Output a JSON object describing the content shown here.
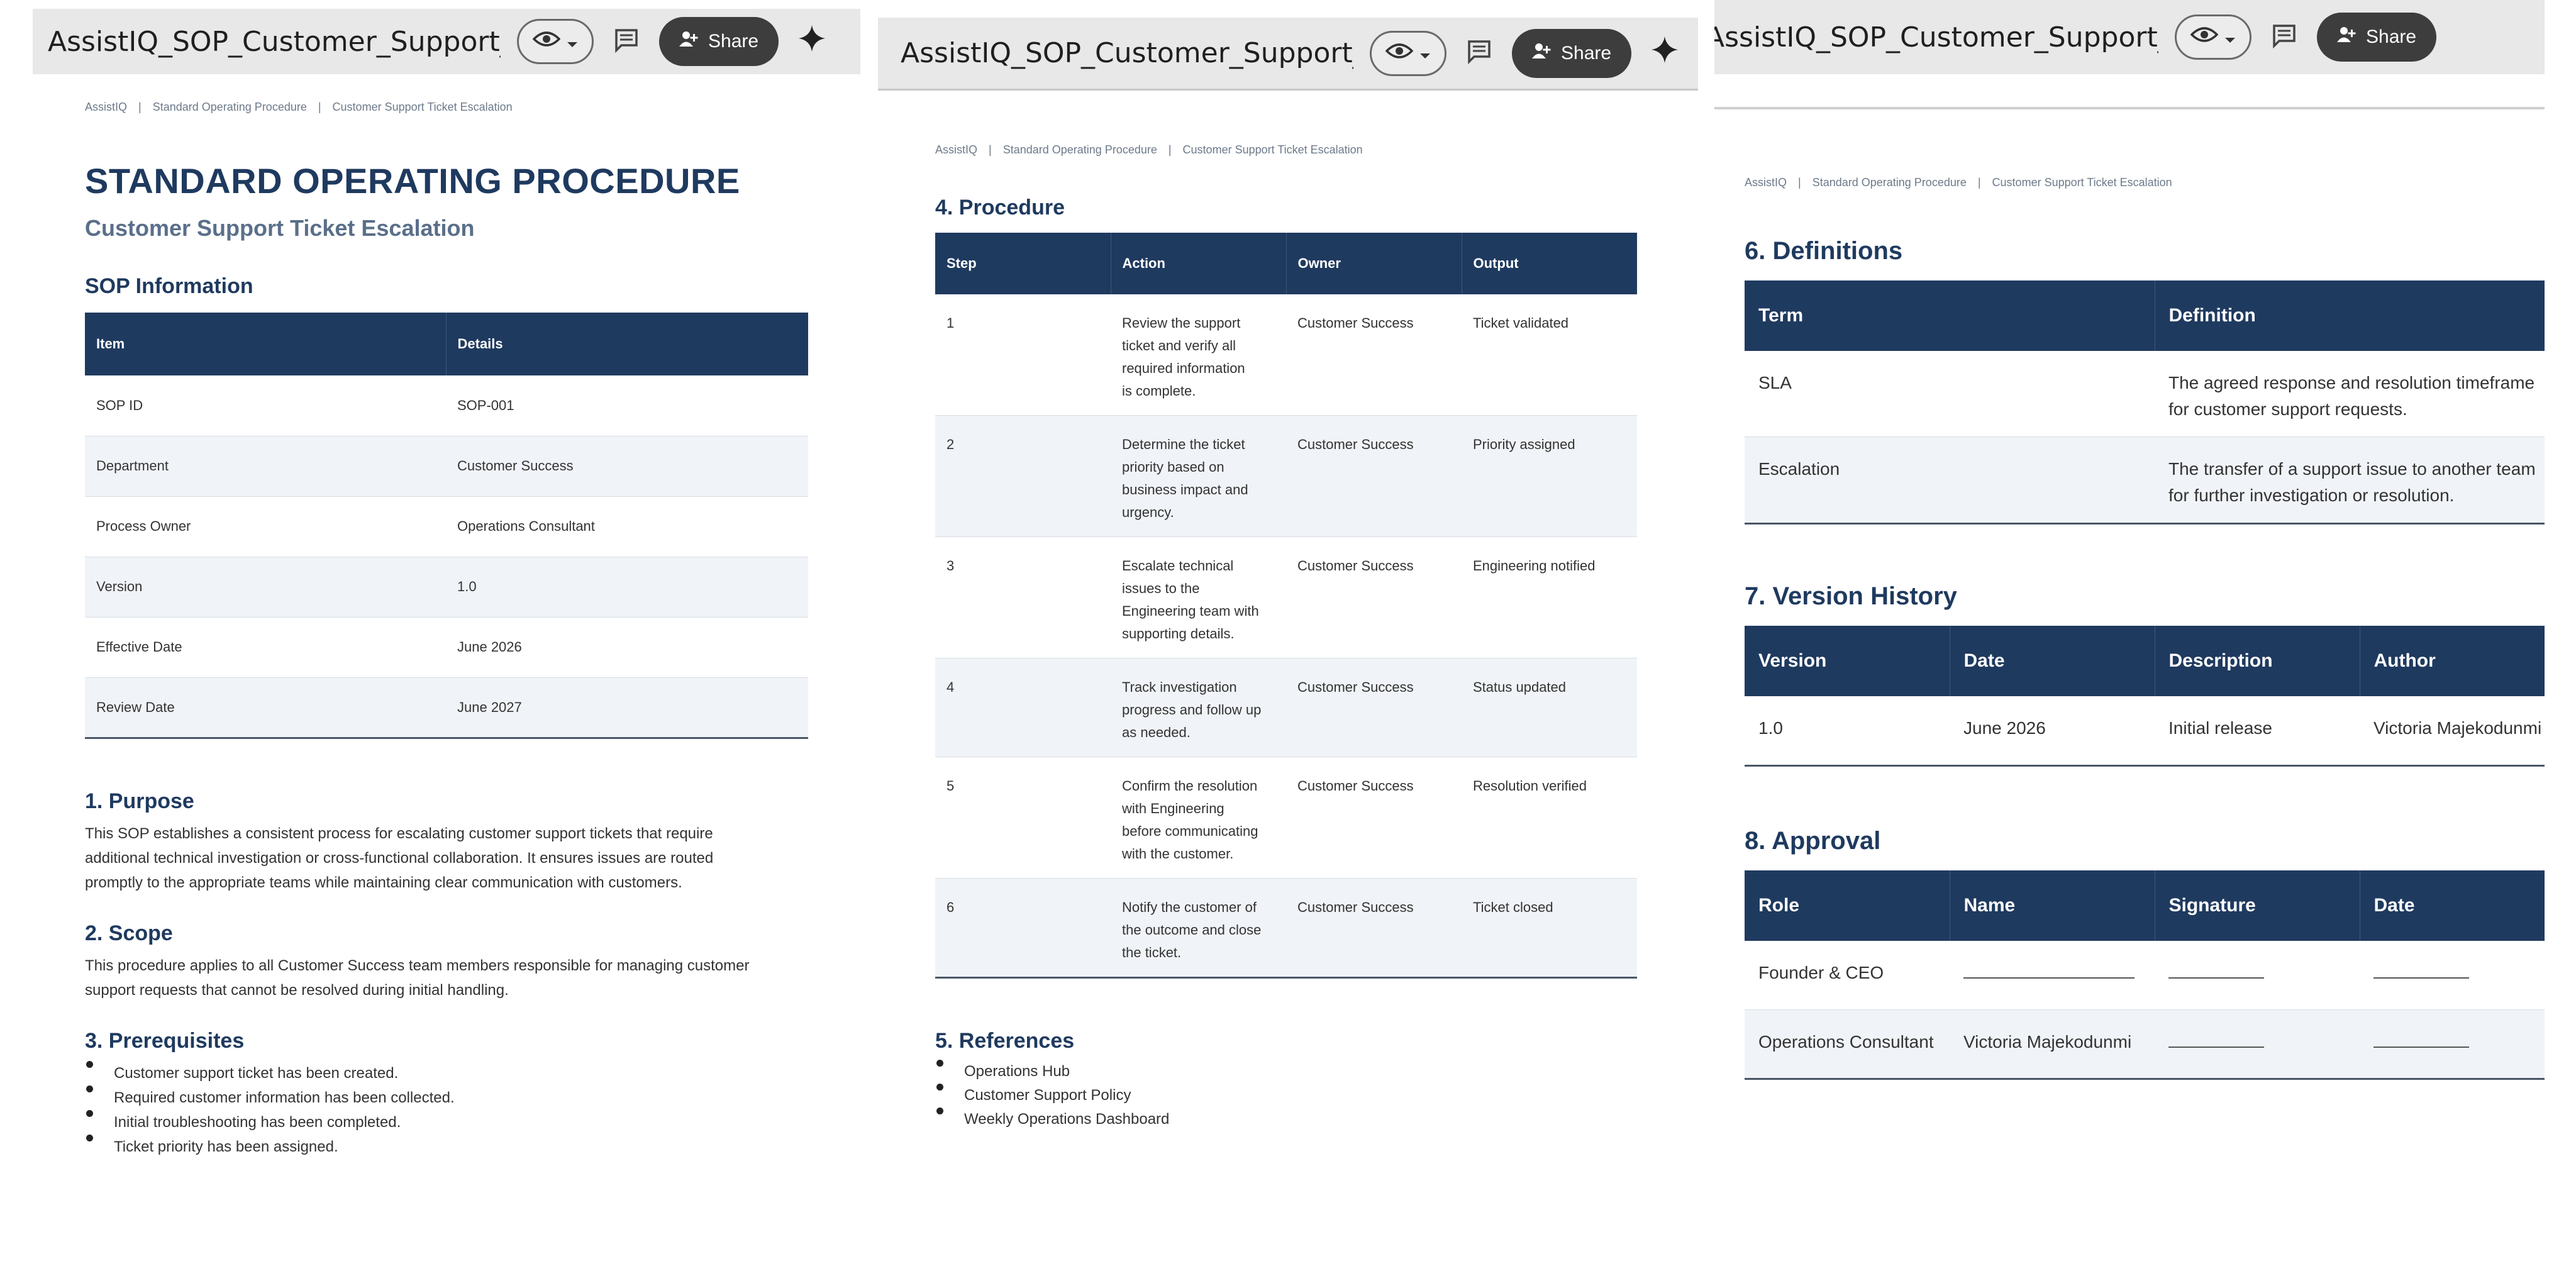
{
  "toolbar": {
    "doc_title": "AssistIQ_SOP_Customer_Support_E...",
    "share_label": "Share",
    "icons": {
      "view": "eye-icon",
      "dropdown": "chevron-down-icon",
      "comment": "comment-icon",
      "share": "person-add-icon",
      "gemini": "sparkle-icon"
    }
  },
  "breadcrumb": {
    "company": "AssistIQ",
    "section": "Standard Operating Procedure",
    "page": "Customer Support Ticket Escalation",
    "separator": "|"
  },
  "header": {
    "title": "STANDARD OPERATING PROCEDURE",
    "subtitle": "Customer Support Ticket Escalation"
  },
  "sop_info": {
    "heading": "SOP Information",
    "columns": [
      "Item",
      "Details"
    ],
    "rows": [
      [
        "SOP ID",
        "SOP-001"
      ],
      [
        "Department",
        "Customer Success"
      ],
      [
        "Process Owner",
        "Operations Consultant"
      ],
      [
        "Version",
        "1.0"
      ],
      [
        "Effective Date",
        "June 2026"
      ],
      [
        "Review Date",
        "June 2027"
      ]
    ]
  },
  "purpose": {
    "heading": "1. Purpose",
    "lines": [
      "This SOP establishes a consistent process for escalating customer support tickets that require",
      "additional technical investigation or cross-functional collaboration. It ensures issues are routed",
      "promptly to the appropriate teams while maintaining clear communication with customers."
    ]
  },
  "scope": {
    "heading": "2. Scope",
    "lines": [
      "This procedure applies to all Customer Success team members responsible for managing customer",
      "support requests that cannot be resolved during initial handling."
    ]
  },
  "prerequisites": {
    "heading": "3. Prerequisites",
    "items": [
      "Customer support ticket has been created.",
      "Required customer information has been collected.",
      "Initial troubleshooting has been completed.",
      "Ticket priority has been assigned."
    ]
  },
  "procedure": {
    "heading": "4. Procedure",
    "columns": [
      "Step",
      "Action",
      "Owner",
      "Output"
    ],
    "rows": [
      {
        "step": "1",
        "action": [
          "Review the support",
          "ticket and verify all",
          "required information",
          "is complete."
        ],
        "owner": "Customer Success",
        "output": "Ticket validated"
      },
      {
        "step": "2",
        "action": [
          "Determine the ticket",
          "priority based on",
          "business impact and",
          "urgency."
        ],
        "owner": "Customer Success",
        "output": "Priority assigned"
      },
      {
        "step": "3",
        "action": [
          "Escalate technical",
          "issues to the",
          "Engineering team with",
          "supporting details."
        ],
        "owner": "Customer Success",
        "output": "Engineering notified"
      },
      {
        "step": "4",
        "action": [
          "Track investigation",
          "progress and follow up",
          "as needed."
        ],
        "owner": "Customer Success",
        "output": "Status updated"
      },
      {
        "step": "5",
        "action": [
          "Confirm the resolution",
          "with Engineering",
          "before communicating",
          "with the customer."
        ],
        "owner": "Customer Success",
        "output": "Resolution verified"
      },
      {
        "step": "6",
        "action": [
          "Notify the customer of",
          "the outcome and close",
          "the ticket."
        ],
        "owner": "Customer Success",
        "output": "Ticket closed"
      }
    ]
  },
  "references": {
    "heading": "5. References",
    "items": [
      "Operations Hub",
      "Customer Support Policy",
      "Weekly Operations Dashboard"
    ]
  },
  "definitions": {
    "heading": "6. Definitions",
    "columns": [
      "Term",
      "Definition"
    ],
    "rows": [
      {
        "term": "SLA",
        "definition": [
          "The agreed response and resolution timeframe",
          "for customer support requests."
        ]
      },
      {
        "term": "Escalation",
        "definition": [
          "The transfer of a support issue to another team",
          "for further investigation or resolution."
        ]
      }
    ]
  },
  "version_history": {
    "heading": "7. Version History",
    "columns": [
      "Version",
      "Date",
      "Description",
      "Author"
    ],
    "rows": [
      [
        "1.0",
        "June 2026",
        "Initial release",
        "Victoria Majekodunmi"
      ]
    ]
  },
  "approval": {
    "heading": "8. Approval",
    "columns": [
      "Role",
      "Name",
      "Signature",
      "Date"
    ],
    "rows": [
      {
        "role": "Founder & CEO",
        "name": "",
        "name_blank": true
      },
      {
        "role": "Operations Consultant",
        "name": "Victoria Majekodunmi",
        "name_blank": false
      }
    ]
  },
  "colors": {
    "header_fill": "#1f3a5f",
    "heading_text": "#1f3a5f",
    "alt_row": "#f0f3f7",
    "toolbar_bg": "#e8e8e8",
    "share_bg": "#3d3d3d"
  }
}
